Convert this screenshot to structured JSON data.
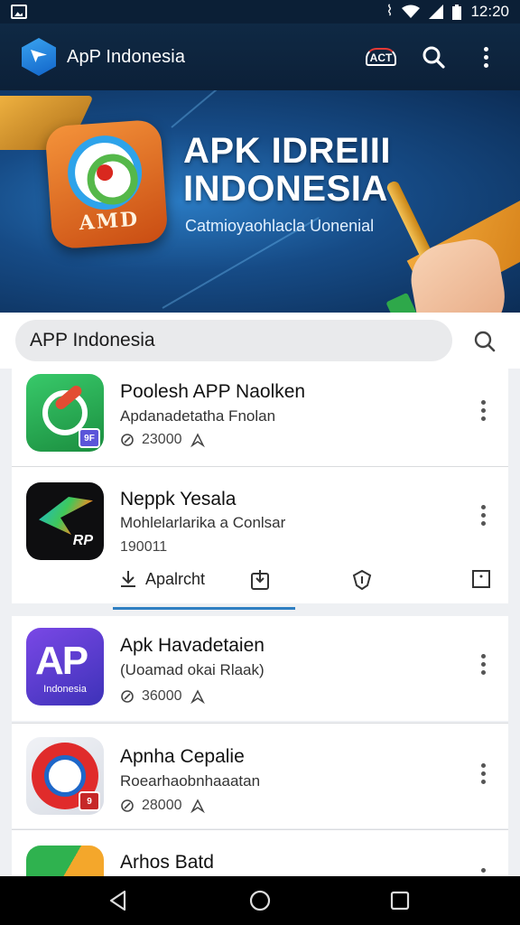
{
  "status_bar": {
    "time": "12:20"
  },
  "app_bar": {
    "title": "ApP Indonesia",
    "badge_label": "ACT"
  },
  "banner": {
    "icon_text": "AMD",
    "headline_1": "APK IDREIII",
    "headline_2": "INDONESIA",
    "subtitle": "Catmioyaohlacla Uonenial",
    "page_count": 3
  },
  "search": {
    "value": "APP Indonesia"
  },
  "apps": [
    {
      "name": "Poolesh APP Naolken",
      "subtitle": "Apdanadetatha Fnolan",
      "count": "23000",
      "badge": "9F"
    },
    {
      "name": "Neppk Yesala",
      "subtitle": "Mohlelarlarika a Conlsar",
      "count": "190011",
      "badge": "RP"
    },
    {
      "name": "Apk Havadetaien",
      "subtitle": "(Uoamad okai Rlaak)",
      "count": "36000",
      "badge": "AP",
      "badge_sub": "Indonesia"
    },
    {
      "name": "Apnha Cepalie",
      "subtitle": "Roearhaobnhaaatan",
      "count": "28000",
      "badge": "9"
    },
    {
      "name": "Arhos Batd"
    }
  ],
  "actions": {
    "install_label": "Apalrcht"
  },
  "colors": {
    "app_bar": "#0f2944",
    "accent": "#2f7fc2",
    "nav_bar": "#000000"
  }
}
